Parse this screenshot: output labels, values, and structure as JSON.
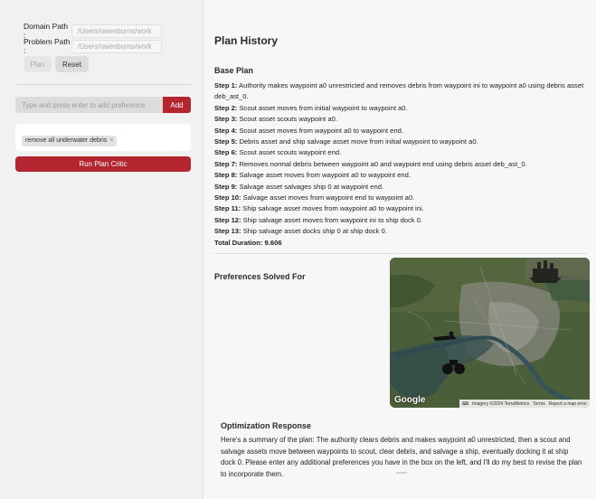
{
  "sidebar": {
    "domain_label": "Domain Path :",
    "domain_placeholder": "/Users/owenburns/work",
    "problem_label": "Problem Path :",
    "problem_placeholder": "/Users/owenburns/work",
    "plan_label": "Plan",
    "reset_label": "Reset",
    "pref_placeholder": "Type and press enter to add preference",
    "add_label": "Add",
    "tags": [
      "remove all underwater debris"
    ],
    "tag_close": "×",
    "run_label": "Run Plan Critic"
  },
  "main": {
    "title": "Plan History",
    "base_plan_heading": "Base Plan",
    "steps": [
      {
        "label": "Step 1:",
        "text": "Authority makes waypoint a0 unrestricted and removes debris from waypoint ini to waypoint a0 using debris asset deb_ast_0."
      },
      {
        "label": "Step 2:",
        "text": "Scout asset moves from initial waypoint to waypoint a0."
      },
      {
        "label": "Step 3:",
        "text": "Scout asset scouts waypoint a0."
      },
      {
        "label": "Step 4:",
        "text": "Scout asset moves from waypoint a0 to waypoint end."
      },
      {
        "label": "Step 5:",
        "text": "Debris asset and ship salvage asset move from initial waypoint to waypoint a0."
      },
      {
        "label": "Step 6:",
        "text": "Scout asset scouts waypoint end."
      },
      {
        "label": "Step 7:",
        "text": "Removes normal debris between waypoint a0 and waypoint end using debris asset deb_ast_0."
      },
      {
        "label": "Step 8:",
        "text": "Salvage asset moves from waypoint a0 to waypoint end."
      },
      {
        "label": "Step 9:",
        "text": "Salvage asset salvages ship 0 at waypoint end."
      },
      {
        "label": "Step 10:",
        "text": "Salvage asset moves from waypoint end to waypoint a0."
      },
      {
        "label": "Step 11:",
        "text": "Ship salvage asset moves from waypoint a0 to waypoint ini."
      },
      {
        "label": "Step 12:",
        "text": "Ship salvage asset moves from waypoint ini to ship dock 0."
      },
      {
        "label": "Step 13:",
        "text": "Ship salvage asset docks ship 0 at ship dock 0."
      }
    ],
    "total_duration": "Total Duration: 9.606",
    "preferences_heading": "Preferences Solved For",
    "map": {
      "google_label": "Google",
      "imagery": "Imagery ©2024 TerraMetrics",
      "terms": "Terms",
      "report": "Report a map error"
    },
    "optimization_heading": "Optimization Response",
    "optimization_text": "Here's a summary of the plan: The authority clears debris and makes waypoint a0 unrestricted, then a scout and salvage assets move between waypoints to scout, clear debris, and salvage a ship, eventually docking it at ship dock 0. Please enter any additional preferences you have in the box on the left, and I'll do my best to revise the plan to incorporate them."
  },
  "colors": {
    "accent": "#b3262f",
    "panel": "#f1f1f1",
    "content": "#f7f7f7"
  }
}
